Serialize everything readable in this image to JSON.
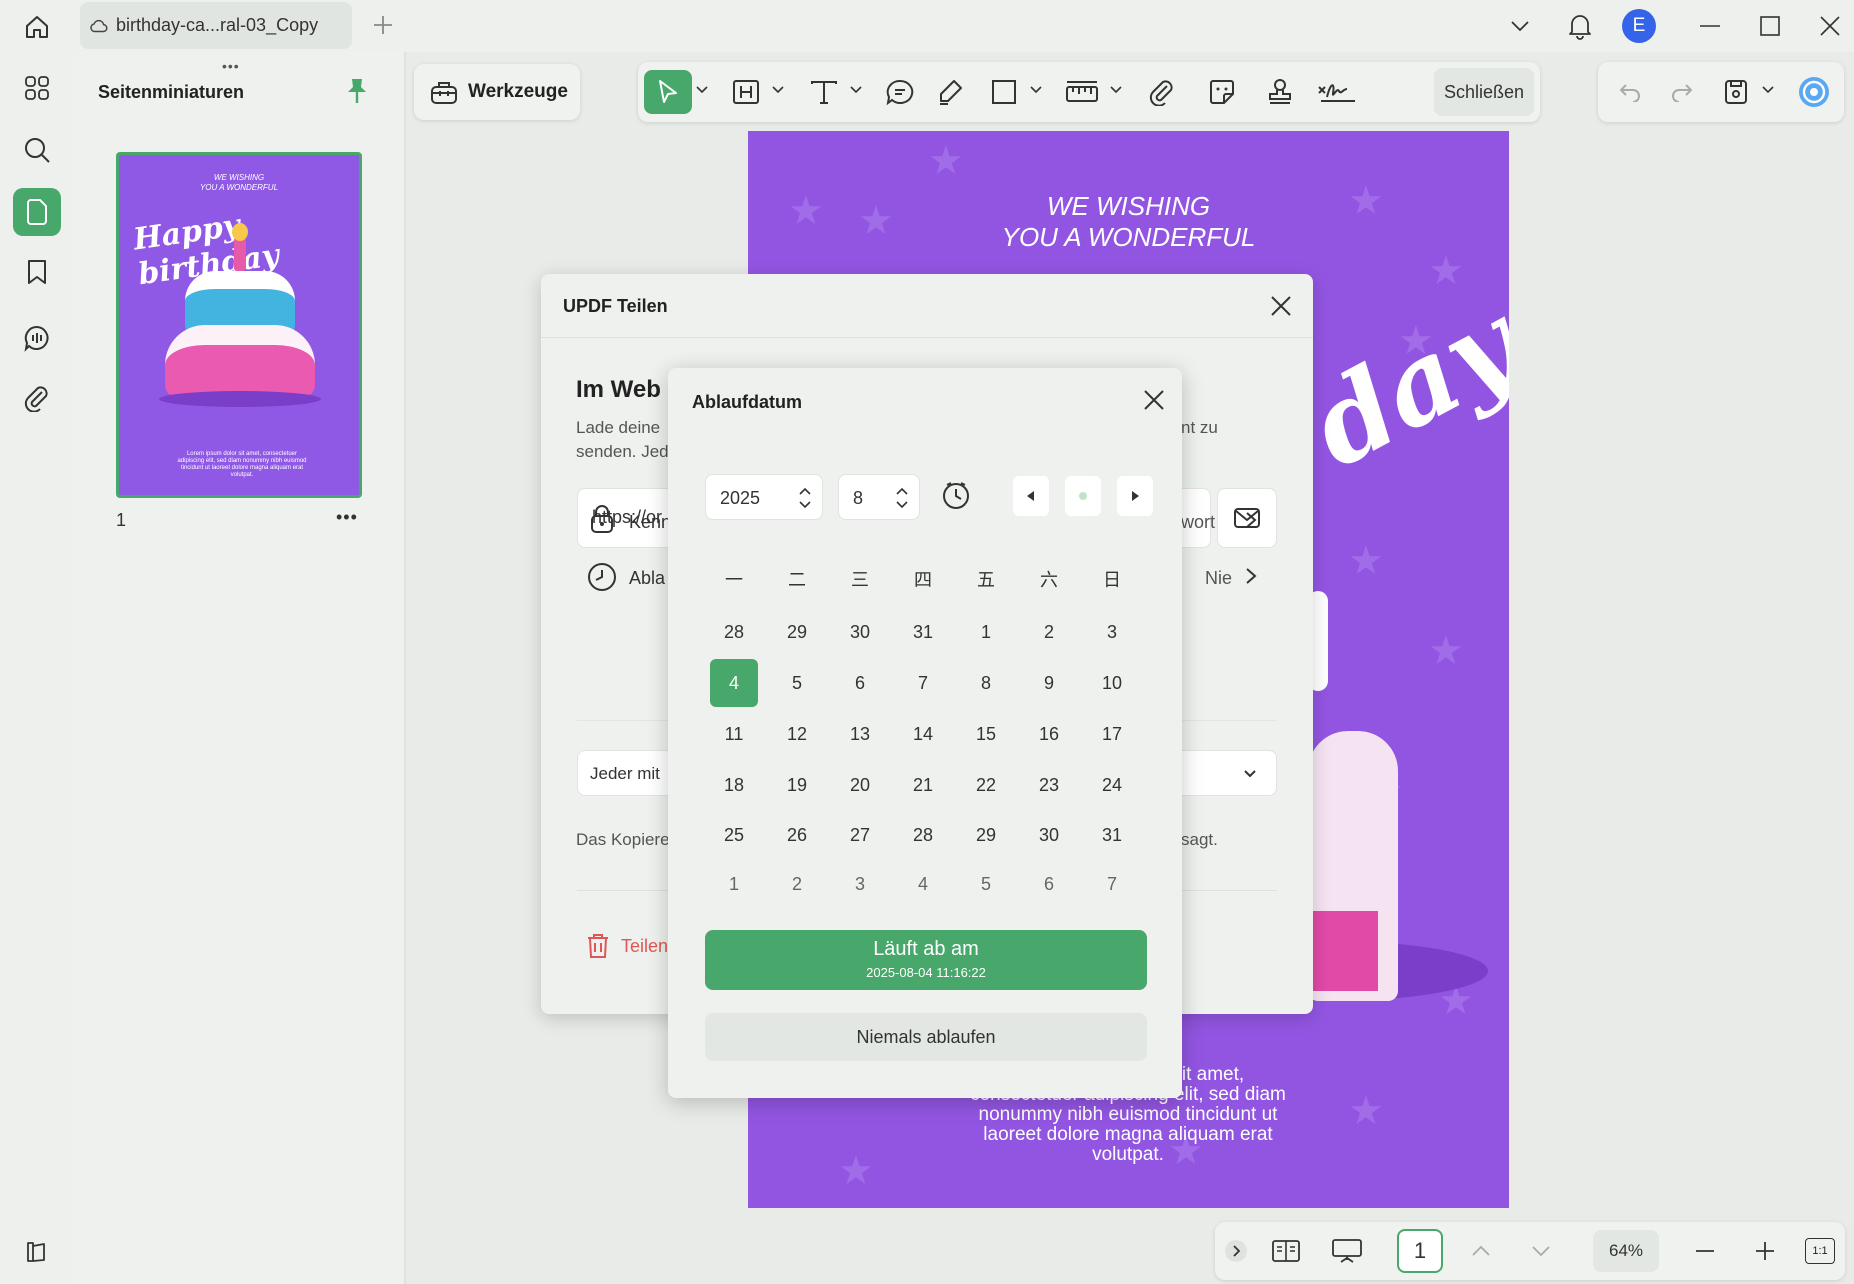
{
  "titlebar": {
    "tab_label": "birthday-ca...ral-03_Copy",
    "avatar_initial": "E"
  },
  "thumbnails": {
    "title": "Seitenminiaturen",
    "page_number": "1",
    "thumb_heading_line1": "WE WISHING",
    "thumb_heading_line2": "YOU A WONDERFUL",
    "thumb_script": "Happy birthday",
    "thumb_body": "Lorem ipsum dolor sit amet, consectetuer adipiscing elit, sed diam nonummy nibh euismod tincidunt ut laoreet dolore magna aliquam erat volutpat."
  },
  "toolbar": {
    "tools_label": "Werkzeuge",
    "close_label": "Schließen"
  },
  "page": {
    "heading_line1": "WE WISHING",
    "heading_line2": "YOU A WONDERFUL",
    "script_fragment": "day",
    "body_line1": "it amet,",
    "body_line2": "consectetuer adipiscing elit, sed diam",
    "body_line3": "nonummy nibh euismod tincidunt ut",
    "body_line4": "laoreet dolore magna aliquam erat",
    "body_line5": "volutpat."
  },
  "share_dialog": {
    "title": "UPDF Teilen",
    "heading": "Im Web",
    "desc_line1": "Lade deine",
    "desc_line2": "senden. Jed",
    "desc_right": "nt zu",
    "link_value": "https://or",
    "password_label": "Kenn",
    "password_value": "wort",
    "expiry_label": "Abla",
    "expiry_value": "Nie",
    "access_value": "Jeder mit",
    "copy_note": "Das Kopiere",
    "copy_note_right": "sagt.",
    "delete_label": "Teilen"
  },
  "date_picker": {
    "title": "Ablaufdatum",
    "year": "2025",
    "month": "8",
    "weekdays": [
      "一",
      "二",
      "三",
      "四",
      "五",
      "六",
      "日"
    ],
    "weeks": [
      [
        "28",
        "29",
        "30",
        "31",
        "1",
        "2",
        "3"
      ],
      [
        "4",
        "5",
        "6",
        "7",
        "8",
        "9",
        "10"
      ],
      [
        "11",
        "12",
        "13",
        "14",
        "15",
        "16",
        "17"
      ],
      [
        "18",
        "19",
        "20",
        "21",
        "22",
        "23",
        "24"
      ],
      [
        "25",
        "26",
        "27",
        "28",
        "29",
        "30",
        "31"
      ],
      [
        "1",
        "2",
        "3",
        "4",
        "5",
        "6",
        "7"
      ]
    ],
    "selected_day": "4",
    "expire_label": "Läuft ab am",
    "expire_datetime": "2025-08-04 11:16:22",
    "never_label": "Niemals ablaufen"
  },
  "bottombar": {
    "page_number": "1",
    "zoom": "64%",
    "fit_label": "1:1"
  },
  "colors": {
    "accent": "#48a76a",
    "page_purple": "#9255e2",
    "danger": "#e05656",
    "avatar_blue": "#3563e9"
  }
}
